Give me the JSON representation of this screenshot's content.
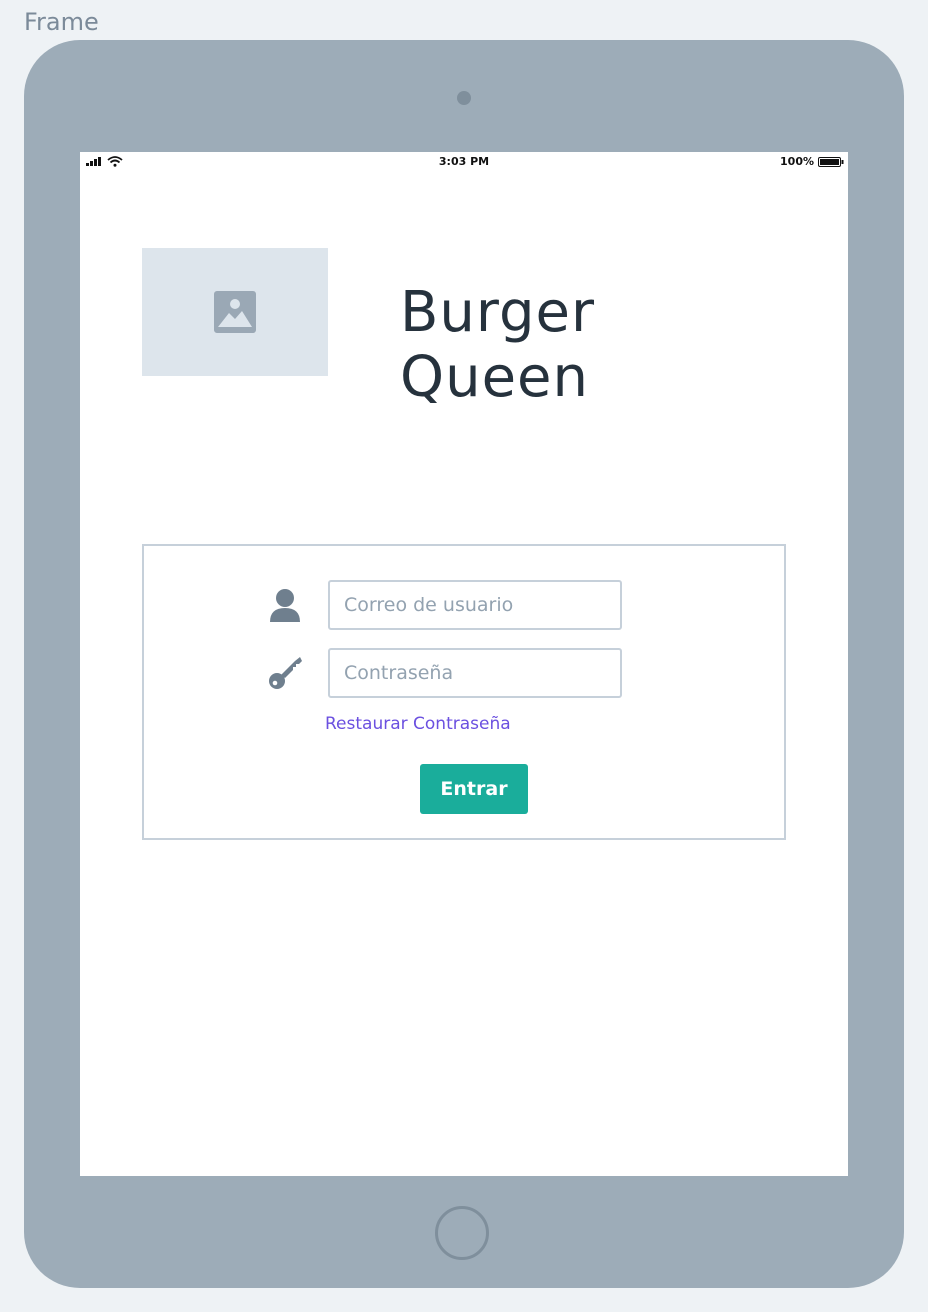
{
  "frame": {
    "label": "Frame"
  },
  "status_bar": {
    "time": "3:03 PM",
    "battery_percent": "100%"
  },
  "header": {
    "title": "Burger Queen",
    "logo_icon": "image-placeholder-icon"
  },
  "login_form": {
    "email_placeholder": "Correo de usuario",
    "email_value": "",
    "password_placeholder": "Contraseña",
    "password_value": "",
    "restore_link": "Restaurar Contraseña",
    "submit_label": "Entrar",
    "icons": {
      "email": "user-icon",
      "password": "key-icon"
    }
  },
  "colors": {
    "device": "#9dacb8",
    "title_text": "#26323d",
    "link": "#6b50e0",
    "primary_button": "#1aad9b",
    "icon": "#6f7f8e",
    "border": "#c6d0da"
  }
}
